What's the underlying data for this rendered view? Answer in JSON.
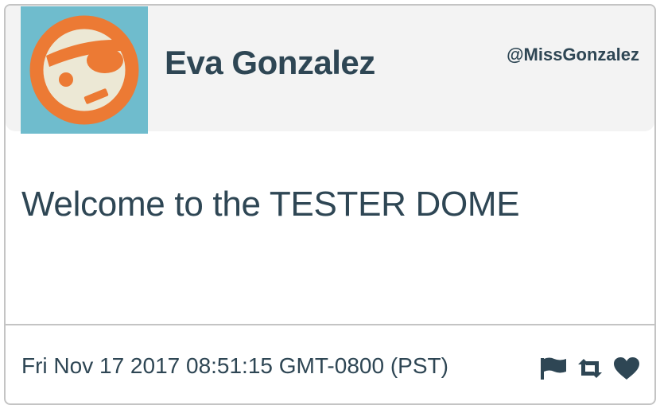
{
  "tweet": {
    "author_name": "Eva Gonzalez",
    "handle": "@MissGonzalez",
    "message": "Welcome to the TESTER DOME",
    "timestamp": "Fri Nov 17 2017 08:51:15 GMT-0800 (PST)",
    "avatar_icon": "pirate-face-avatar",
    "actions": [
      {
        "icon": "flag-icon"
      },
      {
        "icon": "retweet-icon"
      },
      {
        "icon": "heart-icon"
      }
    ]
  },
  "colors": {
    "text": "#2e4654",
    "header_bg": "#f3f3f3",
    "border": "#c4c4c4",
    "avatar_bg": "#6fbccd",
    "avatar_ring": "#ec7a34",
    "avatar_face": "#ece8d5"
  }
}
